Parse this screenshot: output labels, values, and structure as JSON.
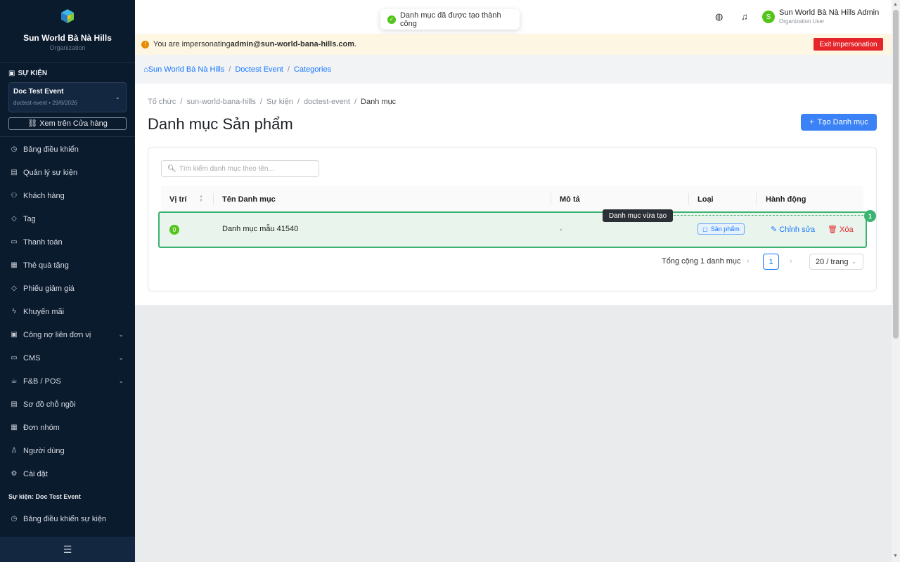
{
  "sidebar": {
    "org_name": "Sun World Bà Nà Hills",
    "org_sub": "Organization",
    "section_title": "SỰ KIỆN",
    "event": {
      "name": "Doc Test Event",
      "meta": "doctest-event • 29/8/2026"
    },
    "store_button": "Xem trên Cửa hàng",
    "items": [
      {
        "label": "Bảng điều khiển",
        "icon": "dashboard-icon"
      },
      {
        "label": "Quản lý sự kiện",
        "icon": "calendar-icon"
      },
      {
        "label": "Khách hàng",
        "icon": "users-icon"
      },
      {
        "label": "Tag",
        "icon": "tag-icon"
      },
      {
        "label": "Thanh toán",
        "icon": "payment-icon"
      },
      {
        "label": "Thẻ quà tặng",
        "icon": "gift-icon"
      },
      {
        "label": "Phiếu giảm giá",
        "icon": "coupon-icon"
      },
      {
        "label": "Khuyến mãi",
        "icon": "promotion-icon"
      },
      {
        "label": "Công nợ liên đơn vị",
        "icon": "debt-icon",
        "expandable": true
      },
      {
        "label": "CMS",
        "icon": "cms-icon",
        "expandable": true
      },
      {
        "label": "F&B / POS",
        "icon": "coffee-icon",
        "expandable": true
      },
      {
        "label": "Sơ đồ chỗ ngồi",
        "icon": "seat-map-icon"
      },
      {
        "label": "Đơn nhóm",
        "icon": "group-order-icon"
      },
      {
        "label": "Người dùng",
        "icon": "user-icon"
      },
      {
        "label": "Cài đặt",
        "icon": "settings-icon"
      }
    ],
    "sub_title": "Sự kiện: Doc Test Event",
    "sub_items": [
      {
        "label": "Bảng điều khiển sự kiện",
        "icon": "dashboard-icon"
      }
    ]
  },
  "topbar": {
    "toast": "Danh mục đã được tạo thành công",
    "user_initial": "S",
    "user_name": "Sun World Bà Nà Hills Admin",
    "user_role": "Organization User"
  },
  "impersonation": {
    "prefix": "You are impersonating ",
    "email": "admin@sun-world-bana-hills.com",
    "suffix": ".",
    "exit_label": "Exit impersonation"
  },
  "crumbs": [
    "Sun World Bà Nà Hills",
    "Doctest Event",
    "Categories"
  ],
  "page": {
    "breadcrumb": [
      "Tổ chức",
      "sun-world-bana-hills",
      "Sự kiện",
      "doctest-event",
      "Danh mục"
    ],
    "title": "Danh mục Sản phẩm",
    "create_label": "Tạo Danh mục",
    "search_placeholder": "Tìm kiếm danh mục theo tên...",
    "columns": [
      "Vị trí",
      "Tên Danh mục",
      "Mô tả",
      "Loại",
      "Hành động"
    ],
    "rows": [
      {
        "position": "0",
        "name": "Danh mục mẫu 41540",
        "description": "-",
        "type": "Sản phẩm",
        "edit": "Chỉnh sửa",
        "delete": "Xóa"
      }
    ],
    "tooltip": "Danh mục vừa tạo",
    "badge": "1",
    "pagination": {
      "total": "Tổng cộng 1 danh mục",
      "page": "1",
      "page_size": "20 / trang"
    }
  },
  "colors": {
    "sidebar_bg": "#0b1b2e",
    "primary": "#3b82f6",
    "success": "#52c41a",
    "danger": "#e5252a"
  }
}
